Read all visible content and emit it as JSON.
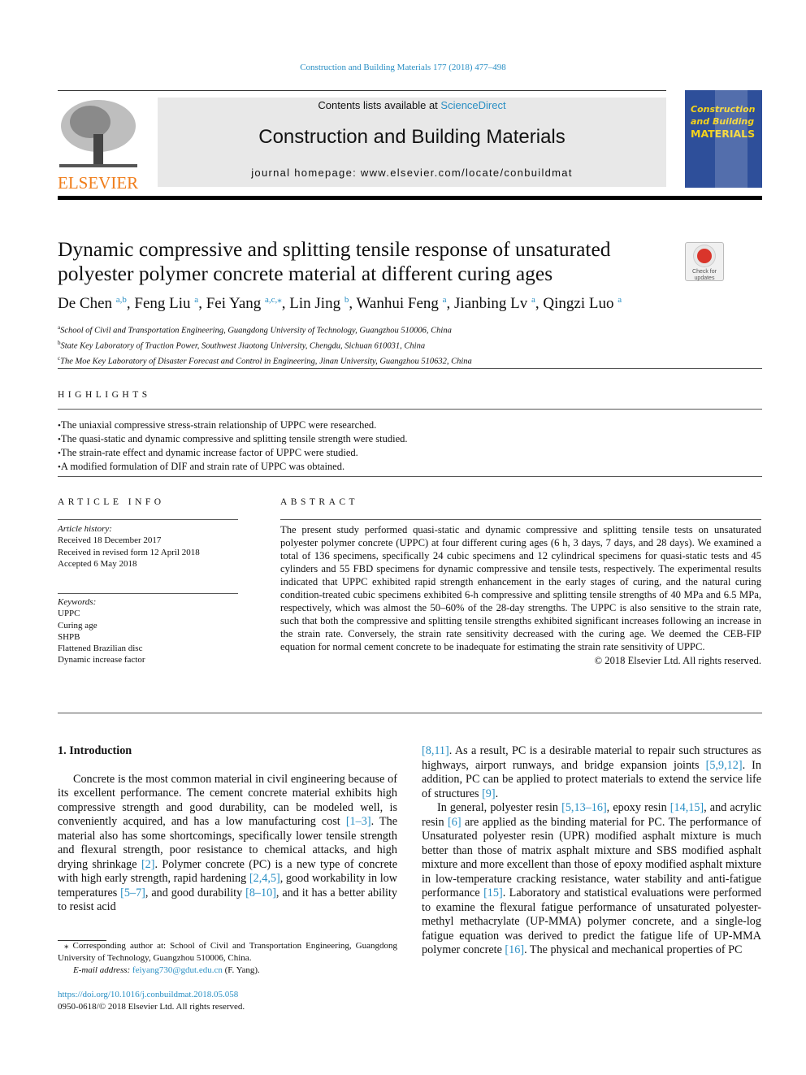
{
  "header": {
    "citation": "Construction and Building Materials 177 (2018) 477–498",
    "contents_prefix": "Contents lists available at ",
    "contents_link": "ScienceDirect",
    "journal_title": "Construction and Building Materials",
    "homepage": "journal homepage: www.elsevier.com/locate/conbuildmat",
    "publisher_logo": "ELSEVIER",
    "cover": {
      "line1": "Construction",
      "line2": "and Building",
      "line3": "MATERIALS"
    },
    "check_updates": "Check for updates"
  },
  "article": {
    "title": "Dynamic compressive and splitting tensile response of unsaturated polyester polymer concrete material at different curing ages",
    "authors": [
      {
        "name": "De Chen",
        "sup": "a,b",
        "sep": ", "
      },
      {
        "name": "Feng Liu",
        "sup": "a",
        "sep": ", "
      },
      {
        "name": "Fei Yang",
        "sup": "a,c,⁎",
        "sep": ", "
      },
      {
        "name": "Lin Jing",
        "sup": "b",
        "sep": ", "
      },
      {
        "name": "Wanhui Feng",
        "sup": "a",
        "sep": ", "
      },
      {
        "name": "Jianbing Lv",
        "sup": "a",
        "sep": ", "
      },
      {
        "name": "Qingzi Luo",
        "sup": "a",
        "sep": ""
      }
    ],
    "affiliations": [
      {
        "key": "a",
        "text": "School of Civil and Transportation Engineering, Guangdong University of Technology, Guangzhou 510006, China"
      },
      {
        "key": "b",
        "text": "State Key Laboratory of Traction Power, Southwest Jiaotong University, Chengdu, Sichuan 610031, China"
      },
      {
        "key": "c",
        "text": "The Moe Key Laboratory of Disaster Forecast and Control in Engineering, Jinan University, Guangzhou 510632, China"
      }
    ]
  },
  "highlights": {
    "heading": "HIGHLIGHTS",
    "items": [
      "The uniaxial compressive stress-strain relationship of UPPC were researched.",
      "The quasi-static and dynamic compressive and splitting tensile strength were studied.",
      "The strain-rate effect and dynamic increase factor of UPPC were studied.",
      "A modified formulation of DIF and strain rate of UPPC was obtained."
    ]
  },
  "article_info": {
    "heading": "ARTICLE INFO",
    "history_label": "Article history:",
    "history": [
      "Received 18 December 2017",
      "Received in revised form 12 April 2018",
      "Accepted 6 May 2018"
    ],
    "keywords_label": "Keywords:",
    "keywords": [
      "UPPC",
      "Curing age",
      "SHPB",
      "Flattened Brazilian disc",
      "Dynamic increase factor"
    ]
  },
  "abstract": {
    "heading": "ABSTRACT",
    "text": "The present study performed quasi-static and dynamic compressive and splitting tensile tests on unsaturated polyester polymer concrete (UPPC) at four different curing ages (6 h, 3 days, 7 days, and 28 days). We examined a total of 136 specimens, specifically 24 cubic specimens and 12 cylindrical specimens for quasi-static tests and 45 cylinders and 55 FBD specimens for dynamic compressive and tensile tests, respectively. The experimental results indicated that UPPC exhibited rapid strength enhancement in the early stages of curing, and the natural curing condition-treated cubic specimens exhibited 6-h compressive and splitting tensile strengths of 40 MPa and 6.5 MPa, respectively, which was almost the 50–60% of the 28-day strengths. The UPPC is also sensitive to the strain rate, such that both the compressive and splitting tensile strengths exhibited significant increases following an increase in the strain rate. Conversely, the strain rate sensitivity decreased with the curing age. We deemed the CEB-FIP equation for normal cement concrete to be inadequate for estimating the strain rate sensitivity of UPPC.",
    "copyright": "© 2018 Elsevier Ltd. All rights reserved."
  },
  "body": {
    "section_heading": "1. Introduction",
    "left_paragraphs": [
      [
        {
          "t": "Concrete is the most common material in civil engineering because of its excellent performance. The cement concrete material exhibits high compressive strength and good durability, can be modeled well, is conveniently acquired, and has a low manufacturing cost "
        },
        {
          "t": "[1–3]",
          "l": 1
        },
        {
          "t": ". The material also has some shortcomings, specifically lower tensile strength and flexural strength, poor resistance to chemical attacks, and high drying shrinkage "
        },
        {
          "t": "[2]",
          "l": 1
        },
        {
          "t": ". Polymer concrete (PC) is a new type of concrete with high early strength, rapid hardening "
        },
        {
          "t": "[2,4,5]",
          "l": 1
        },
        {
          "t": ", good workability in low temperatures "
        },
        {
          "t": "[5–7]",
          "l": 1
        },
        {
          "t": ", and good durability "
        },
        {
          "t": "[8–10]",
          "l": 1
        },
        {
          "t": ", and it has a better ability to resist acid"
        }
      ]
    ],
    "right_paragraphs": [
      [
        {
          "t": "[8,11]",
          "l": 1
        },
        {
          "t": ". As a result, PC is a desirable material to repair such structures as highways, airport runways, and bridge expansion joints "
        },
        {
          "t": "[5,9,12]",
          "l": 1
        },
        {
          "t": ". In addition, PC can be applied to protect materials to extend the service life of structures "
        },
        {
          "t": "[9]",
          "l": 1
        },
        {
          "t": "."
        }
      ],
      [
        {
          "t": "In general, polyester resin "
        },
        {
          "t": "[5,13–16]",
          "l": 1
        },
        {
          "t": ", epoxy resin "
        },
        {
          "t": "[14,15]",
          "l": 1
        },
        {
          "t": ", and acrylic resin "
        },
        {
          "t": "[6]",
          "l": 1
        },
        {
          "t": " are applied as the binding material for PC. The performance of Unsaturated polyester resin (UPR) modified asphalt mixture is much better than those of matrix asphalt mixture and SBS modified asphalt mixture and more excellent than those of epoxy modified asphalt mixture in low-temperature cracking resistance, water stability and anti-fatigue performance "
        },
        {
          "t": "[15]",
          "l": 1
        },
        {
          "t": ". Laboratory and statistical evaluations were performed to examine the flexural fatigue performance of unsaturated polyester-methyl methacrylate (UP-MMA) polymer concrete, and a single-log fatigue equation was derived to predict the fatigue life of UP-MMA polymer concrete "
        },
        {
          "t": "[16]",
          "l": 1
        },
        {
          "t": ". The physical and mechanical properties of PC"
        }
      ]
    ]
  },
  "footnote": {
    "corresponding": "⁎ Corresponding author at: School of Civil and Transportation Engineering, Guangdong University of Technology, Guangzhou 510006, China.",
    "email_label": "E-mail address: ",
    "email": "feiyang730@gdut.edu.cn",
    "email_suffix": " (F. Yang).",
    "doi": "https://doi.org/10.1016/j.conbuildmat.2018.05.058",
    "issn": "0950-0618/© 2018 Elsevier Ltd. All rights reserved."
  },
  "colors": {
    "link": "#2a8fc4",
    "elsevier_orange": "#f07d1a",
    "cover_blue": "#2e4f9a"
  }
}
